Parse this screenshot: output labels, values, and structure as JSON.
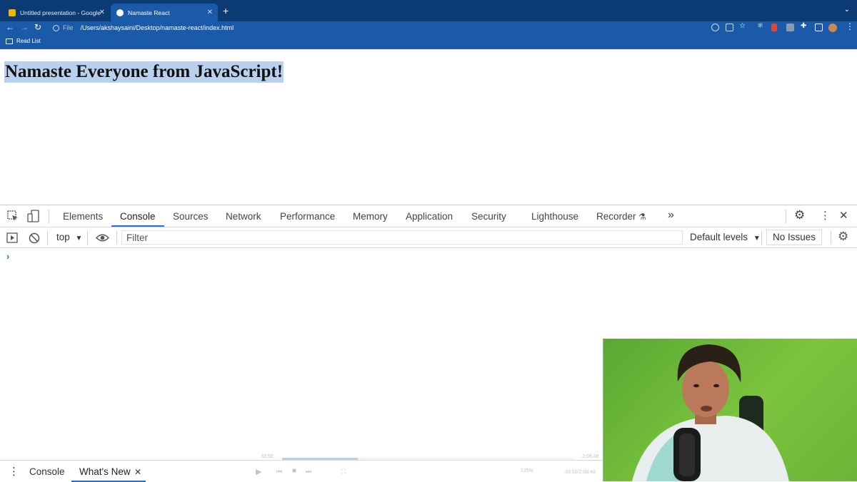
{
  "browser": {
    "tabs": [
      {
        "title": "Untitled presentation - Google",
        "active": false
      },
      {
        "title": "Namaste React",
        "active": true
      }
    ],
    "url_scheme": "File",
    "url_path": "/Users/akshaysaini/Desktop/namaste-react/index.html",
    "bookmarks": [
      {
        "label": "Read List"
      }
    ],
    "colors": {
      "tabstrip": "#0c3a72",
      "toolbar": "#1a5aa8"
    }
  },
  "page": {
    "heading": "Namaste Everyone from JavaScript!",
    "selection_color": "#b9d1ee"
  },
  "devtools": {
    "tabs": [
      "Elements",
      "Console",
      "Sources",
      "Network",
      "Performance",
      "Memory",
      "Application",
      "Security",
      "Lighthouse",
      "Recorder"
    ],
    "active_tab": "Console",
    "console": {
      "context": "top",
      "filter_placeholder": "Filter",
      "levels": "Default levels",
      "issues": "No Issues",
      "prompt": "›"
    },
    "drawer": {
      "tabs": [
        "Console",
        "What's New"
      ],
      "active": "What's New"
    }
  },
  "player": {
    "elapsed": "33:50",
    "duration": "2:08:48",
    "progress_fraction": 0.26,
    "speed": "125%"
  }
}
